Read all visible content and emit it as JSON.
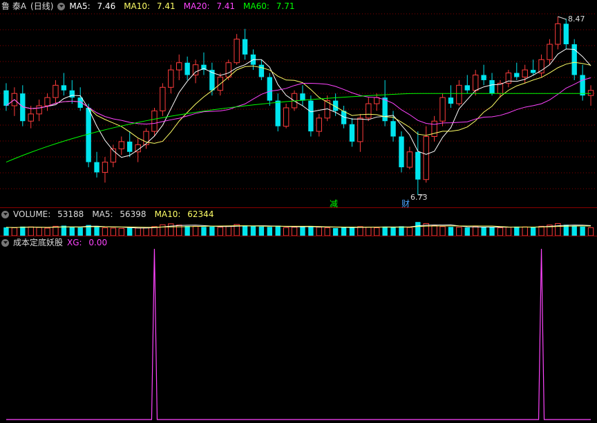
{
  "main_header": {
    "stock_name": "鲁 泰A",
    "period": "(日线)",
    "ma5_label": "MA5:",
    "ma5_value": "7.46",
    "ma10_label": "MA10:",
    "ma10_value": "7.41",
    "ma20_label": "MA20:",
    "ma20_value": "7.41",
    "ma60_label": "MA60:",
    "ma60_value": "7.71"
  },
  "volume_header": {
    "label": "VOLUME:",
    "value": "53188",
    "ma5_label": "MA5:",
    "ma5_value": "56398",
    "ma10_label": "MA10:",
    "ma10_value": "62344"
  },
  "indicator_header": {
    "name": "成本定底妖股",
    "xg_label": "XG:",
    "xg_value": "0.00"
  },
  "annotations": {
    "high_label": "8.47",
    "low_label": "6.73",
    "marker_jian": "减",
    "marker_cai": "财"
  },
  "colors": {
    "up": "#ff3c3c",
    "down": "#00e5ee",
    "ma5": "#ffffff",
    "ma10": "#ffff66",
    "ma20": "#ff44ff",
    "ma60": "#00ff00",
    "grid": "#8b0000",
    "xg": "#ff44ff"
  },
  "chart_data": [
    {
      "type": "candlestick",
      "series": [
        {
          "name": "MA5",
          "value": 7.46
        },
        {
          "name": "MA10",
          "value": 7.41
        },
        {
          "name": "MA20",
          "value": 7.41
        },
        {
          "name": "MA60",
          "value": 7.71
        }
      ],
      "ylim": [
        6.73,
        8.47
      ],
      "candles": [
        [
          7.75,
          7.82,
          7.55,
          7.6
        ],
        [
          7.6,
          7.78,
          7.5,
          7.72
        ],
        [
          7.72,
          7.8,
          7.4,
          7.45
        ],
        [
          7.45,
          7.6,
          7.38,
          7.52
        ],
        [
          7.52,
          7.66,
          7.45,
          7.6
        ],
        [
          7.6,
          7.72,
          7.55,
          7.68
        ],
        [
          7.68,
          7.85,
          7.62,
          7.8
        ],
        [
          7.8,
          7.92,
          7.7,
          7.75
        ],
        [
          7.75,
          7.85,
          7.62,
          7.68
        ],
        [
          7.68,
          7.78,
          7.55,
          7.58
        ],
        [
          7.58,
          7.62,
          7.0,
          7.05
        ],
        [
          7.05,
          7.15,
          6.9,
          6.95
        ],
        [
          6.95,
          7.1,
          6.85,
          7.05
        ],
        [
          7.05,
          7.22,
          7.0,
          7.18
        ],
        [
          7.18,
          7.3,
          7.12,
          7.25
        ],
        [
          7.25,
          7.35,
          7.1,
          7.15
        ],
        [
          7.15,
          7.28,
          7.05,
          7.22
        ],
        [
          7.22,
          7.38,
          7.18,
          7.35
        ],
        [
          7.35,
          7.58,
          7.3,
          7.55
        ],
        [
          7.55,
          7.82,
          7.5,
          7.78
        ],
        [
          7.78,
          8.0,
          7.72,
          7.95
        ],
        [
          7.95,
          8.1,
          7.85,
          8.02
        ],
        [
          8.02,
          8.08,
          7.85,
          7.9
        ],
        [
          7.9,
          8.05,
          7.82,
          8.0
        ],
        [
          8.0,
          8.12,
          7.9,
          7.95
        ],
        [
          7.95,
          8.02,
          7.7,
          7.75
        ],
        [
          7.75,
          7.92,
          7.7,
          7.88
        ],
        [
          7.88,
          8.05,
          7.85,
          8.02
        ],
        [
          8.02,
          8.3,
          8.0,
          8.25
        ],
        [
          8.25,
          8.35,
          8.05,
          8.1
        ],
        [
          8.1,
          8.15,
          7.95,
          8.0
        ],
        [
          8.0,
          8.05,
          7.85,
          7.88
        ],
        [
          7.88,
          7.92,
          7.6,
          7.65
        ],
        [
          7.65,
          7.72,
          7.35,
          7.4
        ],
        [
          7.4,
          7.62,
          7.38,
          7.58
        ],
        [
          7.58,
          7.75,
          7.55,
          7.72
        ],
        [
          7.72,
          7.8,
          7.6,
          7.65
        ],
        [
          7.65,
          7.7,
          7.3,
          7.35
        ],
        [
          7.35,
          7.52,
          7.3,
          7.48
        ],
        [
          7.48,
          7.7,
          7.45,
          7.65
        ],
        [
          7.65,
          7.72,
          7.5,
          7.55
        ],
        [
          7.55,
          7.6,
          7.38,
          7.42
        ],
        [
          7.42,
          7.48,
          7.2,
          7.25
        ],
        [
          7.25,
          7.52,
          7.15,
          7.48
        ],
        [
          7.48,
          7.68,
          7.45,
          7.62
        ],
        [
          7.62,
          7.72,
          7.55,
          7.68
        ],
        [
          7.68,
          7.85,
          7.4,
          7.45
        ],
        [
          7.45,
          7.55,
          7.25,
          7.3
        ],
        [
          7.3,
          7.35,
          6.95,
          7.0
        ],
        [
          7.0,
          7.2,
          6.98,
          7.15
        ],
        [
          7.15,
          7.35,
          6.73,
          6.88
        ],
        [
          6.88,
          7.4,
          6.85,
          7.3
        ],
        [
          7.3,
          7.5,
          7.25,
          7.45
        ],
        [
          7.45,
          7.72,
          7.4,
          7.68
        ],
        [
          7.68,
          7.8,
          7.58,
          7.62
        ],
        [
          7.62,
          7.85,
          7.6,
          7.8
        ],
        [
          7.8,
          7.9,
          7.72,
          7.75
        ],
        [
          7.75,
          7.95,
          7.7,
          7.9
        ],
        [
          7.9,
          8.0,
          7.8,
          7.85
        ],
        [
          7.85,
          7.92,
          7.7,
          7.72
        ],
        [
          7.72,
          7.85,
          7.68,
          7.82
        ],
        [
          7.82,
          7.95,
          7.78,
          7.92
        ],
        [
          7.92,
          8.02,
          7.85,
          7.88
        ],
        [
          7.88,
          8.0,
          7.82,
          7.95
        ],
        [
          7.95,
          8.05,
          7.9,
          7.92
        ],
        [
          7.92,
          8.1,
          7.88,
          8.05
        ],
        [
          8.05,
          8.25,
          8.0,
          8.2
        ],
        [
          8.2,
          8.47,
          8.15,
          8.4
        ],
        [
          8.4,
          8.45,
          8.15,
          8.2
        ],
        [
          8.2,
          8.25,
          7.85,
          7.9
        ],
        [
          7.9,
          8.0,
          7.65,
          7.7
        ],
        [
          7.7,
          7.8,
          7.6,
          7.75
        ]
      ]
    },
    {
      "type": "bar",
      "name": "VOLUME",
      "values": [
        55,
        52,
        60,
        58,
        54,
        50,
        62,
        66,
        58,
        54,
        70,
        64,
        52,
        50,
        48,
        52,
        50,
        54,
        60,
        72,
        78,
        70,
        64,
        62,
        58,
        60,
        56,
        64,
        74,
        68,
        62,
        60,
        58,
        66,
        54,
        56,
        58,
        64,
        56,
        52,
        50,
        54,
        58,
        60,
        56,
        52,
        60,
        58,
        62,
        54,
        90,
        80,
        66,
        60,
        58,
        56,
        54,
        60,
        56,
        58,
        52,
        56,
        60,
        58,
        56,
        62,
        70,
        80,
        72,
        66,
        60,
        53
      ]
    },
    {
      "type": "line",
      "name": "XG",
      "values": [
        0,
        0,
        0,
        0,
        0,
        0,
        0,
        0,
        0,
        0,
        0,
        0,
        0,
        0,
        0,
        0,
        0,
        0,
        0,
        0,
        0,
        0,
        0,
        0,
        0,
        0,
        0,
        0,
        0,
        0,
        0,
        0,
        0,
        0,
        0,
        0,
        0,
        0,
        0,
        0,
        0,
        0,
        0,
        0,
        0,
        0,
        0,
        0,
        0,
        0,
        0,
        0,
        0,
        0,
        0,
        0,
        0,
        0,
        0,
        0,
        0,
        0,
        0,
        0,
        0,
        0,
        0,
        0,
        0,
        0,
        0,
        0
      ],
      "spikes": [
        18,
        65
      ]
    }
  ]
}
